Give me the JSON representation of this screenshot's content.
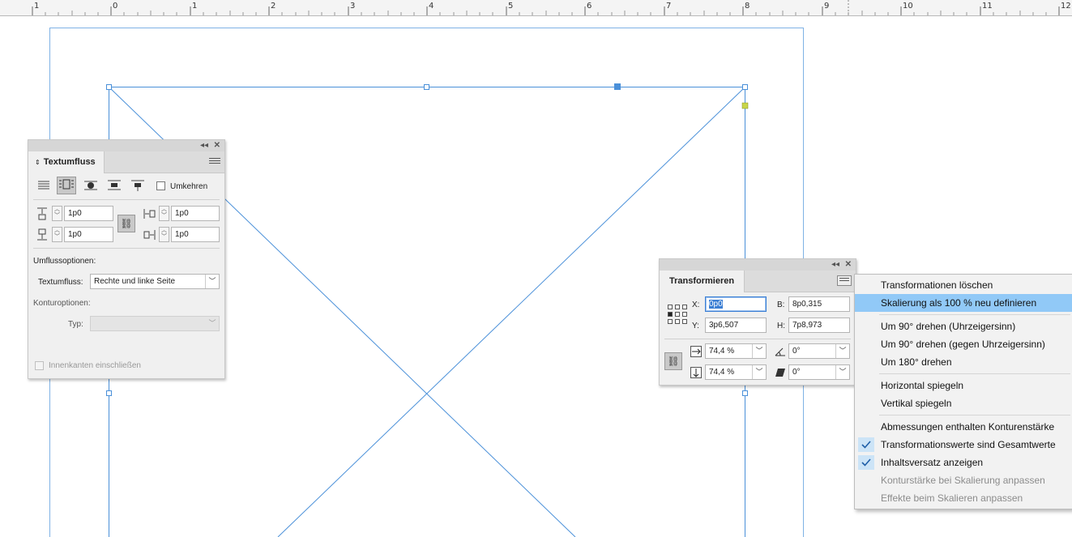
{
  "ruler": {
    "labels": [
      "1",
      "0",
      "1",
      "2",
      "3",
      "4",
      "5",
      "6",
      "7",
      "8",
      "9",
      "10",
      "11",
      "12"
    ]
  },
  "textumfluss": {
    "title": "Textumfluss",
    "invert_label": "Umkehren",
    "offset_top": "1p0",
    "offset_bottom": "1p0",
    "offset_left": "1p0",
    "offset_right": "1p0",
    "wrap_options_label": "Umflussoptionen:",
    "wrap_to_label": "Textumfluss:",
    "wrap_to_value": "Rechte und linke Seite",
    "contour_options_label": "Konturoptionen:",
    "type_label": "Typ:",
    "type_value": "",
    "include_inside_edges_label": "Innenkanten einschließen"
  },
  "transform": {
    "title": "Transformieren",
    "x_label": "X:",
    "x_value": "0p0",
    "y_label": "Y:",
    "y_value": "3p6,507",
    "w_label": "B:",
    "w_value": "8p0,315",
    "h_label": "H:",
    "h_value": "7p8,973",
    "scale_x": "74,4 %",
    "scale_y": "74,4 %",
    "rotation": "0°",
    "shear": "0°"
  },
  "context_menu": {
    "items": [
      {
        "label": "Transformationen löschen",
        "state": "normal"
      },
      {
        "label": "Skalierung als 100 % neu definieren",
        "state": "highlighted"
      },
      {
        "label": "Um 90° drehen (Uhrzeigersinn)",
        "state": "normal"
      },
      {
        "label": "Um 90° drehen (gegen Uhrzeigersinn)",
        "state": "normal"
      },
      {
        "label": "Um 180° drehen",
        "state": "normal"
      },
      {
        "label": "Horizontal spiegeln",
        "state": "normal"
      },
      {
        "label": "Vertikal spiegeln",
        "state": "normal"
      },
      {
        "label": "Abmessungen enthalten Konturenstärke",
        "state": "normal"
      },
      {
        "label": "Transformationswerte sind Gesamtwerte",
        "state": "checked"
      },
      {
        "label": "Inhaltsversatz anzeigen",
        "state": "checked"
      },
      {
        "label": "Konturstärke bei Skalierung anpassen",
        "state": "disabled"
      },
      {
        "label": "Effekte beim Skalieren anpassen",
        "state": "disabled"
      }
    ]
  },
  "colors": {
    "accent": "#4a90d9",
    "frame": "#6aa6db",
    "highlight": "#91c9f7"
  }
}
